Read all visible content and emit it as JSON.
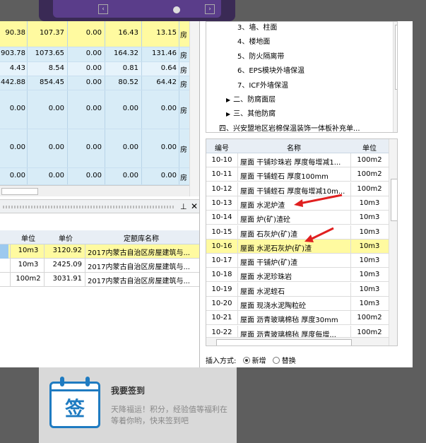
{
  "top_table": {
    "rows": [
      {
        "c1": "90.38",
        "c2": "107.37",
        "c3": "0.00",
        "c4": "16.43",
        "c5": "13.15",
        "c6": "房"
      },
      {
        "c1": "903.78",
        "c2": "1073.65",
        "c3": "0.00",
        "c4": "164.32",
        "c5": "131.46",
        "c6": "房"
      },
      {
        "c1": "4.43",
        "c2": "8.54",
        "c3": "0.00",
        "c4": "0.81",
        "c5": "0.64",
        "c6": "房"
      },
      {
        "c1": "442.88",
        "c2": "854.45",
        "c3": "0.00",
        "c4": "80.52",
        "c5": "64.42",
        "c6": "房"
      },
      {
        "c1": "0.00",
        "c2": "0.00",
        "c3": "0.00",
        "c4": "0.00",
        "c5": "0.00",
        "c6": "房"
      },
      {
        "c1": "0.00",
        "c2": "0.00",
        "c3": "0.00",
        "c4": "0.00",
        "c5": "0.00",
        "c6": "房"
      },
      {
        "c1": "0.00",
        "c2": "0.00",
        "c3": "0.00",
        "c4": "0.00",
        "c5": "0.00",
        "c6": "房"
      }
    ]
  },
  "bottom_table": {
    "headers": {
      "unit": "单位",
      "price": "单价",
      "lib": "定额库名称"
    },
    "rows": [
      {
        "unit": "10m3",
        "price": "3120.92",
        "lib": "2017内蒙古自治区房屋建筑与..."
      },
      {
        "unit": "10m3",
        "price": "2425.09",
        "lib": "2017内蒙古自治区房屋建筑与..."
      },
      {
        "unit": "100m2",
        "price": "3031.91",
        "lib": "2017内蒙古自治区房屋建筑与..."
      }
    ]
  },
  "tree": {
    "items": [
      "3、墙、柱面",
      "4、楼地面",
      "5、防火隔离带",
      "6、EPS模块外墙保温",
      "7、ICF外墙保温",
      "二、防腐面层",
      "三、其他防腐",
      "四、兴安盟地区岩棉保温装饰一体板补充单..."
    ]
  },
  "quota_table": {
    "headers": {
      "code": "编号",
      "name": "名称",
      "unit": "单位"
    },
    "rows": [
      {
        "code": "10-10",
        "name": "屋面 干铺珍珠岩 厚度每增减1...",
        "unit": "100m2"
      },
      {
        "code": "10-11",
        "name": "屋面 干铺蛭石 厚度100mm",
        "unit": "100m2"
      },
      {
        "code": "10-12",
        "name": "屋面 干铺蛭石 厚度每增减10m...",
        "unit": "100m2"
      },
      {
        "code": "10-13",
        "name": "屋面 水泥炉渣",
        "unit": "10m3"
      },
      {
        "code": "10-14",
        "name": "屋面 炉(矿)渣砼",
        "unit": "10m3"
      },
      {
        "code": "10-15",
        "name": "屋面 石灰炉(矿)渣",
        "unit": "10m3"
      },
      {
        "code": "10-16",
        "name": "屋面 水泥石灰炉(矿)渣",
        "unit": "10m3"
      },
      {
        "code": "10-17",
        "name": "屋面 干铺炉(矿)渣",
        "unit": "10m3"
      },
      {
        "code": "10-18",
        "name": "屋面 水泥珍珠岩",
        "unit": "10m3"
      },
      {
        "code": "10-19",
        "name": "屋面 水泥蛭石",
        "unit": "10m3"
      },
      {
        "code": "10-20",
        "name": "屋面 现浇水泥陶粒砼",
        "unit": "10m3"
      },
      {
        "code": "10-21",
        "name": "屋面 沥青玻璃棉毡 厚度30mm",
        "unit": "100m2"
      },
      {
        "code": "10-22",
        "name": "屋面 沥青玻璃棉毡 厚度每增...",
        "unit": "100m2"
      }
    ]
  },
  "insert": {
    "label": "插入方式:",
    "opt1": "新增",
    "opt2": "替换"
  },
  "card": {
    "icon_text": "签",
    "title": "我要签到",
    "desc": "天降福运！积分，经验值等福利在等着你哟，快来签到吧"
  },
  "splitter": {
    "pin": "⊥",
    "close": "✕"
  },
  "colors": {
    "highlight": "#fffaa0",
    "accent_blue": "#1f7bc1",
    "arrow_red": "#e02020"
  }
}
